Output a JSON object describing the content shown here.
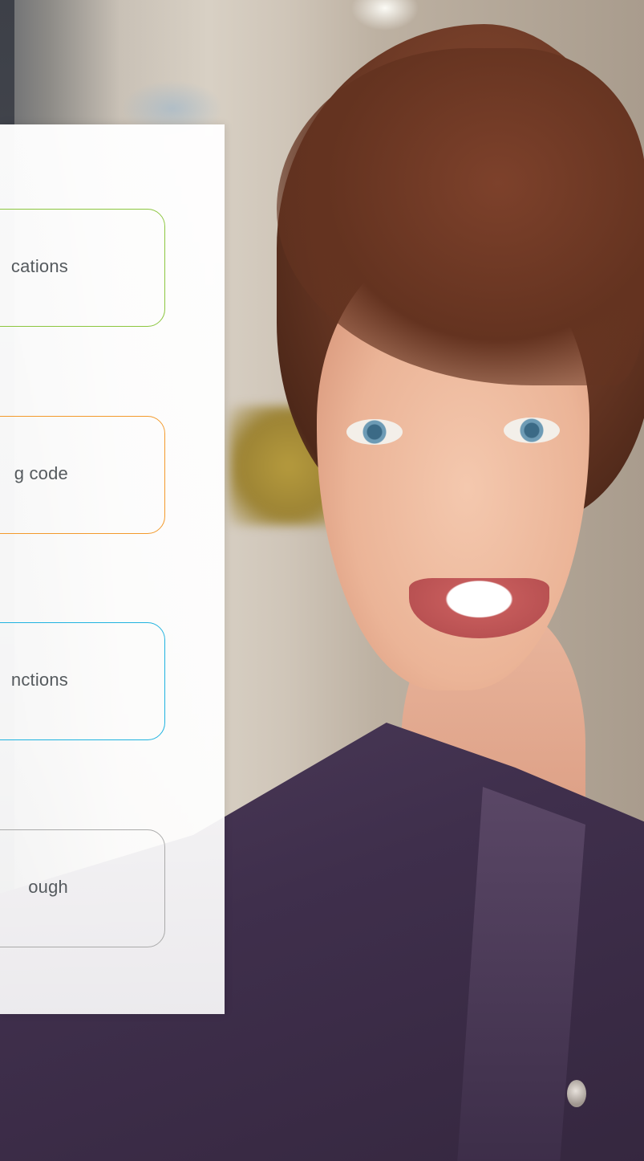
{
  "options": [
    {
      "label": "cations",
      "border_color": "#8cc63f"
    },
    {
      "label": "g code",
      "border_color": "#f39a2c"
    },
    {
      "label": "nctions",
      "border_color": "#1fb3e0"
    },
    {
      "label": "ough",
      "border_color": "#aaaaaa"
    }
  ],
  "background": {
    "description_icon": "portrait-photo"
  }
}
